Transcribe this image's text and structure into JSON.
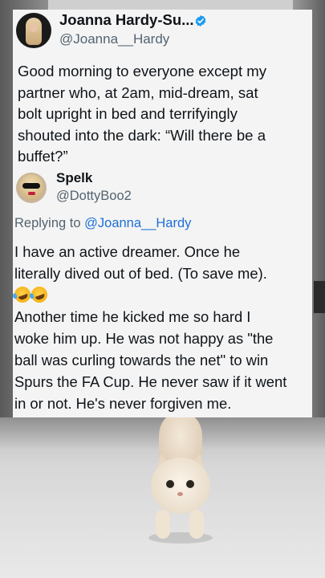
{
  "tweet": {
    "author_name": "Joanna Hardy-Su...",
    "author_handle": "@Joanna__Hardy",
    "text_lines": [
      "Good morning to everyone except my",
      "partner who, at 2am, mid-dream, sat",
      "bolt upright in bed and terrifyingly",
      "shouted into the dark: “Will there be a",
      "buffet?”"
    ]
  },
  "reply": {
    "author_name": "Spelk",
    "author_handle": "@DottyBoo2",
    "replying_label": "Replying to",
    "replying_mention": "@Joanna__Hardy",
    "text_lines": [
      "I have an active dreamer. Once he",
      "literally dived out of bed. (To save me).",
      "",
      "Another time he kicked me so hard I",
      "woke him up. He was not happy as \"the",
      "ball was curling towards the net\" to win",
      "Spurs the FA Cup. He never saw if it went",
      "in or not. He's never forgiven me."
    ]
  },
  "icons": {
    "verified": "verified-badge-icon",
    "emoji": "rolling-on-floor-laughing-emoji"
  },
  "colors": {
    "card_bg": "#f4f4f4",
    "text": "#0f1419",
    "muted": "#536471",
    "link": "#1d6fd6",
    "verified": "#1d9bf0"
  }
}
